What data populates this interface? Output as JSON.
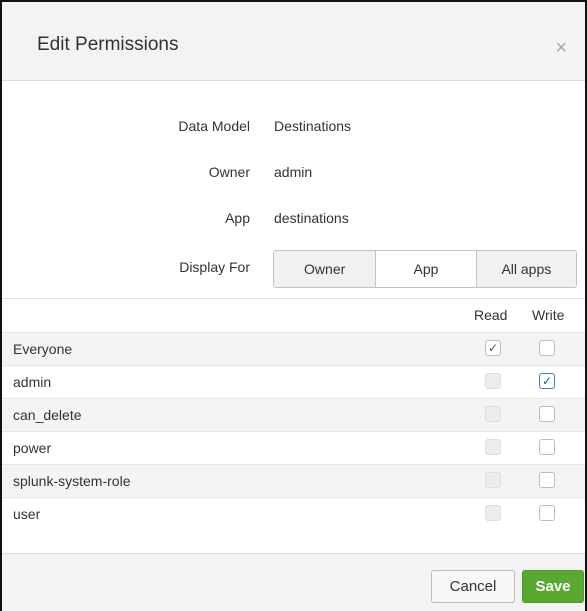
{
  "dialog": {
    "title": "Edit Permissions",
    "close_label": "×"
  },
  "form": {
    "data_model_label": "Data Model",
    "data_model_value": "Destinations",
    "owner_label": "Owner",
    "owner_value": "admin",
    "app_label": "App",
    "app_value": "destinations",
    "display_for_label": "Display For",
    "display_for_options": [
      "Owner",
      "App",
      "All apps"
    ],
    "display_for_selected": "App"
  },
  "permissions": {
    "read_header": "Read",
    "write_header": "Write",
    "roles": [
      {
        "name": "Everyone",
        "read": true,
        "write": false,
        "read_enabled": true
      },
      {
        "name": "admin",
        "read": false,
        "write": true,
        "read_enabled": false
      },
      {
        "name": "can_delete",
        "read": false,
        "write": false,
        "read_enabled": false
      },
      {
        "name": "power",
        "read": false,
        "write": false,
        "read_enabled": false
      },
      {
        "name": "splunk-system-role",
        "read": false,
        "write": false,
        "read_enabled": false
      },
      {
        "name": "user",
        "read": false,
        "write": false,
        "read_enabled": false
      }
    ]
  },
  "footer": {
    "cancel_label": "Cancel",
    "save_label": "Save"
  },
  "colors": {
    "save_button": "#5aa832",
    "header_background": "#f3f3f3",
    "checked_write_border": "#3f7fc2"
  },
  "icons": {
    "close": "close-icon",
    "checkmark": "checkmark-icon"
  }
}
